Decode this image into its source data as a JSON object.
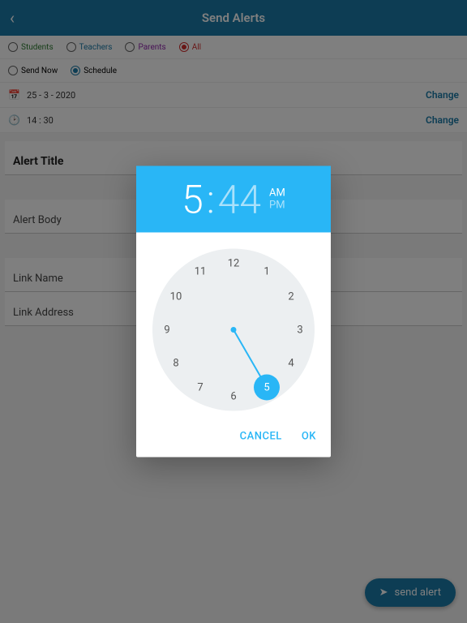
{
  "header": {
    "title": "Send Alerts"
  },
  "filters": {
    "students": "Students",
    "teachers": "Teachers",
    "parents": "Parents",
    "all": "All"
  },
  "timing": {
    "sendNow": "Send Now",
    "schedule": "Schedule"
  },
  "date": {
    "value": "25 - 3 - 2020",
    "change": "Change"
  },
  "time": {
    "value": "14 : 30",
    "change": "Change"
  },
  "fields": {
    "alertTitle": "Alert Title",
    "alertBody": "Alert Body",
    "linkName": "Link Name",
    "linkAddress": "Link Address"
  },
  "fab": {
    "label": "send alert"
  },
  "timePicker": {
    "hour": "5",
    "minute": "44",
    "am": "AM",
    "pm": "PM",
    "selectedHour": 5,
    "numbers": [
      "12",
      "1",
      "2",
      "3",
      "4",
      "5",
      "6",
      "7",
      "8",
      "9",
      "10",
      "11"
    ],
    "cancel": "CANCEL",
    "ok": "OK"
  }
}
